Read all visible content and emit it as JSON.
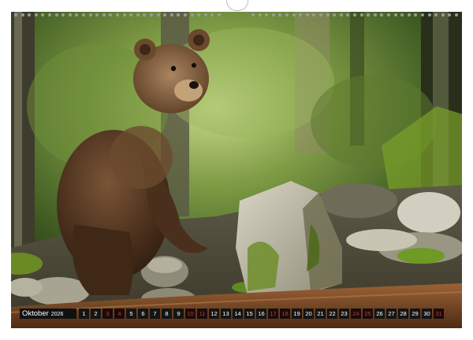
{
  "calendar": {
    "month": "Oktober",
    "year": "2026",
    "days": [
      {
        "n": "1",
        "weekend": false
      },
      {
        "n": "2",
        "weekend": false
      },
      {
        "n": "3",
        "weekend": true
      },
      {
        "n": "4",
        "weekend": true
      },
      {
        "n": "5",
        "weekend": false
      },
      {
        "n": "6",
        "weekend": false
      },
      {
        "n": "7",
        "weekend": false
      },
      {
        "n": "8",
        "weekend": false
      },
      {
        "n": "9",
        "weekend": false
      },
      {
        "n": "10",
        "weekend": true
      },
      {
        "n": "11",
        "weekend": true
      },
      {
        "n": "12",
        "weekend": false
      },
      {
        "n": "13",
        "weekend": false
      },
      {
        "n": "14",
        "weekend": false
      },
      {
        "n": "15",
        "weekend": false
      },
      {
        "n": "16",
        "weekend": false
      },
      {
        "n": "17",
        "weekend": true
      },
      {
        "n": "18",
        "weekend": true
      },
      {
        "n": "19",
        "weekend": false
      },
      {
        "n": "20",
        "weekend": false
      },
      {
        "n": "21",
        "weekend": false
      },
      {
        "n": "22",
        "weekend": false
      },
      {
        "n": "23",
        "weekend": false
      },
      {
        "n": "24",
        "weekend": true
      },
      {
        "n": "25",
        "weekend": true
      },
      {
        "n": "26",
        "weekend": false
      },
      {
        "n": "27",
        "weekend": false
      },
      {
        "n": "28",
        "weekend": false
      },
      {
        "n": "29",
        "weekend": false
      },
      {
        "n": "30",
        "weekend": false
      },
      {
        "n": "31",
        "weekend": true
      }
    ]
  },
  "photo": {
    "subject": "brown-bear-cub",
    "colors": {
      "foliage": "#4f6b2a",
      "bear": "#5a3a22",
      "rock": "#b9b6a6",
      "log": "#7a4a2a"
    }
  }
}
